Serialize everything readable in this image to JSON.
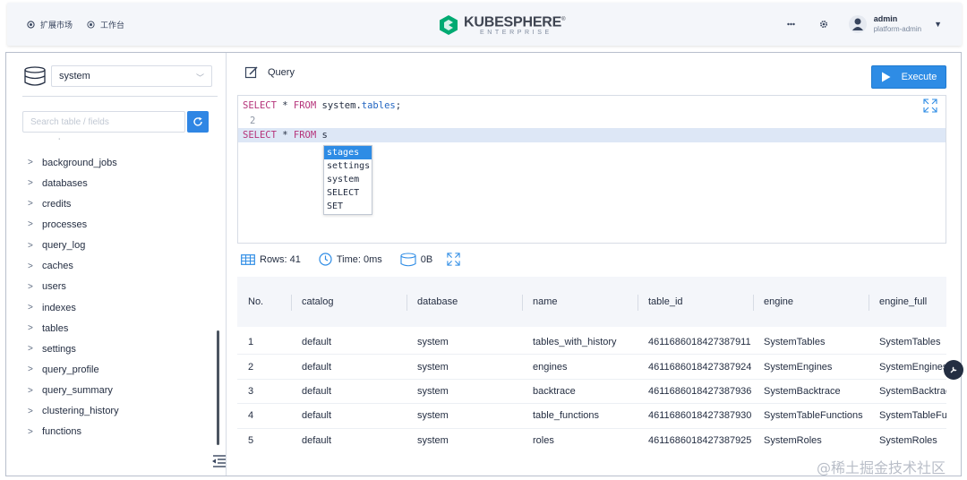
{
  "topnav": {
    "marketplace": "扩展市场",
    "workbench": "工作台"
  },
  "brand": {
    "name": "KUBESPHERE",
    "registered": "®",
    "sub": "ENTERPRISE",
    "color": "#00aa72"
  },
  "topbar_right": {
    "icons": [
      "grid-dots-icon",
      "settings-gear-icon"
    ],
    "user": "admin",
    "role": "platform-admin"
  },
  "sidebar": {
    "database": "system",
    "search_placeholder": "Search table / fields",
    "tables": [
      "background_jobs",
      "databases",
      "credits",
      "processes",
      "query_log",
      "caches",
      "users",
      "indexes",
      "tables",
      "settings",
      "query_profile",
      "query_summary",
      "clustering_history",
      "functions"
    ]
  },
  "query": {
    "label": "Query",
    "execute_label": "Execute",
    "accent": "#2e8ce5"
  },
  "editor": {
    "line1": {
      "select": "SELECT",
      "star": " * ",
      "from": "FROM",
      "rest": " system.",
      "field": "tables",
      "end": ";"
    },
    "line2": "2",
    "line3": {
      "select": "SELECT",
      "star": " * ",
      "from": "FROM",
      "rest": " s"
    },
    "autocomplete": [
      "stages",
      "settings",
      "system",
      "SELECT",
      "SET"
    ]
  },
  "stats": {
    "rows": "Rows: 41",
    "time": "Time: 0ms",
    "size": "0B"
  },
  "table": {
    "columns": [
      "No.",
      "catalog",
      "database",
      "name",
      "table_id",
      "engine",
      "engine_full"
    ],
    "rows": [
      [
        "1",
        "default",
        "system",
        "tables_with_history",
        "4611686018427387911",
        "SystemTables",
        "SystemTables"
      ],
      [
        "2",
        "default",
        "system",
        "engines",
        "4611686018427387924",
        "SystemEngines",
        "SystemEngines"
      ],
      [
        "3",
        "default",
        "system",
        "backtrace",
        "4611686018427387936",
        "SystemBacktrace",
        "SystemBacktrace"
      ],
      [
        "4",
        "default",
        "system",
        "table_functions",
        "4611686018427387930",
        "SystemTableFunctions",
        "SystemTableFunctions"
      ],
      [
        "5",
        "default",
        "system",
        "roles",
        "4611686018427387925",
        "SystemRoles",
        "SystemRoles"
      ]
    ]
  },
  "watermark": "@稀土掘金技术社区"
}
